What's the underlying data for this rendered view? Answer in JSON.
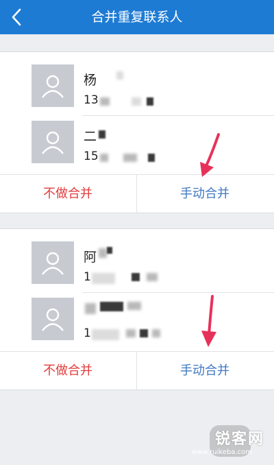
{
  "header": {
    "title": "合并重复联系人",
    "back_icon": "chevron-left-icon"
  },
  "groups": [
    {
      "contacts": [
        {
          "name": "杨",
          "phone": "13"
        },
        {
          "name": "二",
          "phone": "15"
        }
      ],
      "actions": {
        "skip": "不做合并",
        "manual": "手动合并"
      }
    },
    {
      "contacts": [
        {
          "name": "阿",
          "phone": "1"
        },
        {
          "name": "",
          "phone": "1"
        }
      ],
      "actions": {
        "skip": "不做合并",
        "manual": "手动合并"
      }
    }
  ],
  "watermark": {
    "logo_text": "锐客网",
    "url": "www.ruikeba.com"
  },
  "colors": {
    "header": "#1e7bd4",
    "skip_button": "#e23b3b",
    "manual_button": "#3f78c2",
    "arrow": "#e8315a"
  }
}
